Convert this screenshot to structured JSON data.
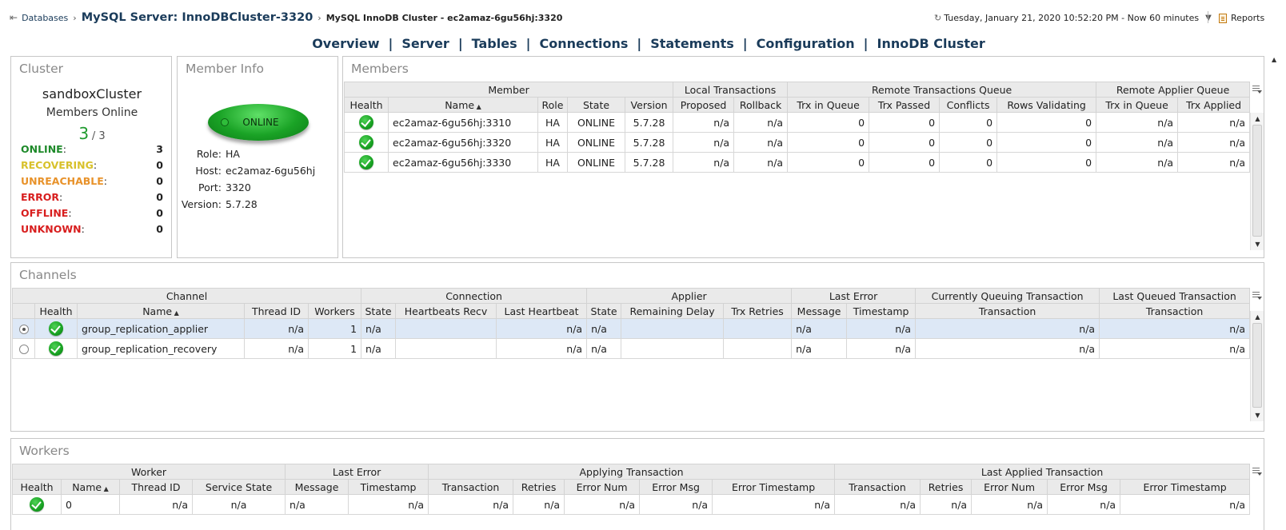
{
  "breadcrumb": {
    "databases": "Databases",
    "server": "MySQL Server: InnoDBCluster-3320",
    "cluster": "MySQL InnoDB Cluster - ec2amaz-6gu56hj:3320"
  },
  "time": {
    "text": "Tuesday, January 21, 2020 10:52:20 PM - Now 60 minutes"
  },
  "reports": {
    "label": "Reports"
  },
  "nav": [
    "Overview",
    "Server",
    "Tables",
    "Connections",
    "Statements",
    "Configuration",
    "InnoDB Cluster"
  ],
  "cluster": {
    "title": "Cluster",
    "name": "sandboxCluster",
    "members_online_label": "Members Online",
    "online_count": "3",
    "total": "/ 3",
    "statuses": [
      {
        "label": "ONLINE",
        "value": "3",
        "color": "#1e8a2a"
      },
      {
        "label": "RECOVERING",
        "value": "0",
        "color": "#d8c12b"
      },
      {
        "label": "UNREACHABLE",
        "value": "0",
        "color": "#e8922a"
      },
      {
        "label": "ERROR",
        "value": "0",
        "color": "#d81e1e"
      },
      {
        "label": "OFFLINE",
        "value": "0",
        "color": "#d81e1e"
      },
      {
        "label": "UNKNOWN",
        "value": "0",
        "color": "#d81e1e"
      }
    ]
  },
  "member_info": {
    "title": "Member Info",
    "state": "ONLINE",
    "role_label": "Role:",
    "role": "HA",
    "host_label": "Host:",
    "host": "ec2amaz-6gu56hj",
    "port_label": "Port:",
    "port": "3320",
    "version_label": "Version:",
    "version": "5.7.28"
  },
  "members": {
    "title": "Members",
    "groups": [
      "Member",
      "Local Transactions",
      "Remote Transactions Queue",
      "Remote Applier Queue"
    ],
    "columns": [
      "Health",
      "Name",
      "Role",
      "State",
      "Version",
      "Proposed",
      "Rollback",
      "Trx in Queue",
      "Trx Passed",
      "Conflicts",
      "Rows Validating",
      "Trx in Queue",
      "Trx Applied"
    ],
    "rows": [
      [
        "ec2amaz-6gu56hj:3310",
        "HA",
        "ONLINE",
        "5.7.28",
        "n/a",
        "n/a",
        "0",
        "0",
        "0",
        "0",
        "n/a",
        "n/a"
      ],
      [
        "ec2amaz-6gu56hj:3320",
        "HA",
        "ONLINE",
        "5.7.28",
        "n/a",
        "n/a",
        "0",
        "0",
        "0",
        "0",
        "n/a",
        "n/a"
      ],
      [
        "ec2amaz-6gu56hj:3330",
        "HA",
        "ONLINE",
        "5.7.28",
        "n/a",
        "n/a",
        "0",
        "0",
        "0",
        "0",
        "n/a",
        "n/a"
      ]
    ]
  },
  "channels": {
    "title": "Channels",
    "groups": [
      "Channel",
      "Connection",
      "Applier",
      "Last Error",
      "Currently Queuing Transaction",
      "Last Queued Transaction"
    ],
    "columns": [
      "Health",
      "Name",
      "Thread ID",
      "Workers",
      "State",
      "Heartbeats Recv",
      "Last Heartbeat",
      "State",
      "Remaining Delay",
      "Trx Retries",
      "Message",
      "Timestamp",
      "Transaction",
      "Transaction"
    ],
    "rows": [
      [
        "group_replication_applier",
        "n/a",
        "1",
        "n/a",
        "",
        "n/a",
        "n/a",
        "",
        "",
        "n/a",
        "n/a",
        "n/a",
        "n/a"
      ],
      [
        "group_replication_recovery",
        "n/a",
        "1",
        "n/a",
        "",
        "n/a",
        "n/a",
        "",
        "",
        "n/a",
        "n/a",
        "n/a",
        "n/a"
      ]
    ]
  },
  "workers": {
    "title": "Workers",
    "groups": [
      "Worker",
      "Last Error",
      "Applying Transaction",
      "Last Applied Transaction"
    ],
    "columns": [
      "Health",
      "Name",
      "Thread ID",
      "Service State",
      "Message",
      "Timestamp",
      "Transaction",
      "Retries",
      "Error Num",
      "Error Msg",
      "Error Timestamp",
      "Transaction",
      "Retries",
      "Error Num",
      "Error Msg",
      "Error Timestamp"
    ],
    "rows": [
      [
        "0",
        "n/a",
        "n/a",
        "n/a",
        "n/a",
        "n/a",
        "n/a",
        "n/a",
        "n/a",
        "n/a",
        "n/a",
        "n/a",
        "n/a",
        "n/a",
        "n/a"
      ]
    ]
  }
}
